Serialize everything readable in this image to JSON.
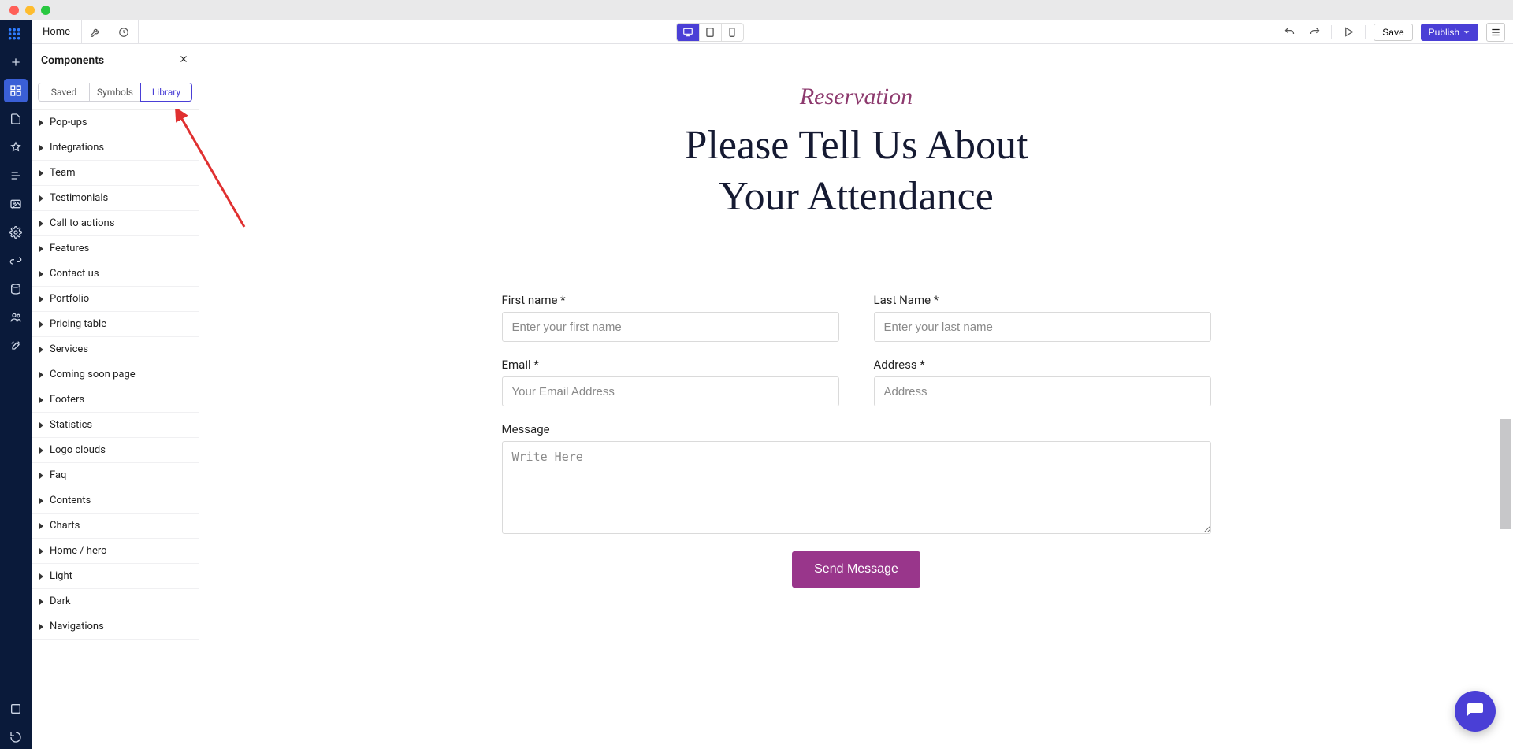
{
  "topbar": {
    "home": "Home",
    "save": "Save",
    "publish": "Publish"
  },
  "panel": {
    "title": "Components",
    "tabs": {
      "saved": "Saved",
      "symbols": "Symbols",
      "library": "Library"
    },
    "categories": [
      "Pop-ups",
      "Integrations",
      "Team",
      "Testimonials",
      "Call to actions",
      "Features",
      "Contact us",
      "Portfolio",
      "Pricing table",
      "Services",
      "Coming soon page",
      "Footers",
      "Statistics",
      "Logo clouds",
      "Faq",
      "Contents",
      "Charts",
      "Home / hero",
      "Light",
      "Dark",
      "Navigations"
    ]
  },
  "page": {
    "subtitle": "Reservation",
    "headline_l1": "Please Tell Us About",
    "headline_l2": "Your Attendance",
    "form": {
      "first_name_label": "First name *",
      "first_name_ph": "Enter your first name",
      "last_name_label": "Last Name *",
      "last_name_ph": "Enter your last name",
      "email_label": "Email *",
      "email_ph": "Your Email Address",
      "address_label": "Address *",
      "address_ph": "Address",
      "message_label": "Message",
      "message_ph": "Write Here",
      "submit": "Send Message"
    }
  },
  "colors": {
    "accent": "#4a3fd6",
    "brand_pink": "#99368b"
  }
}
